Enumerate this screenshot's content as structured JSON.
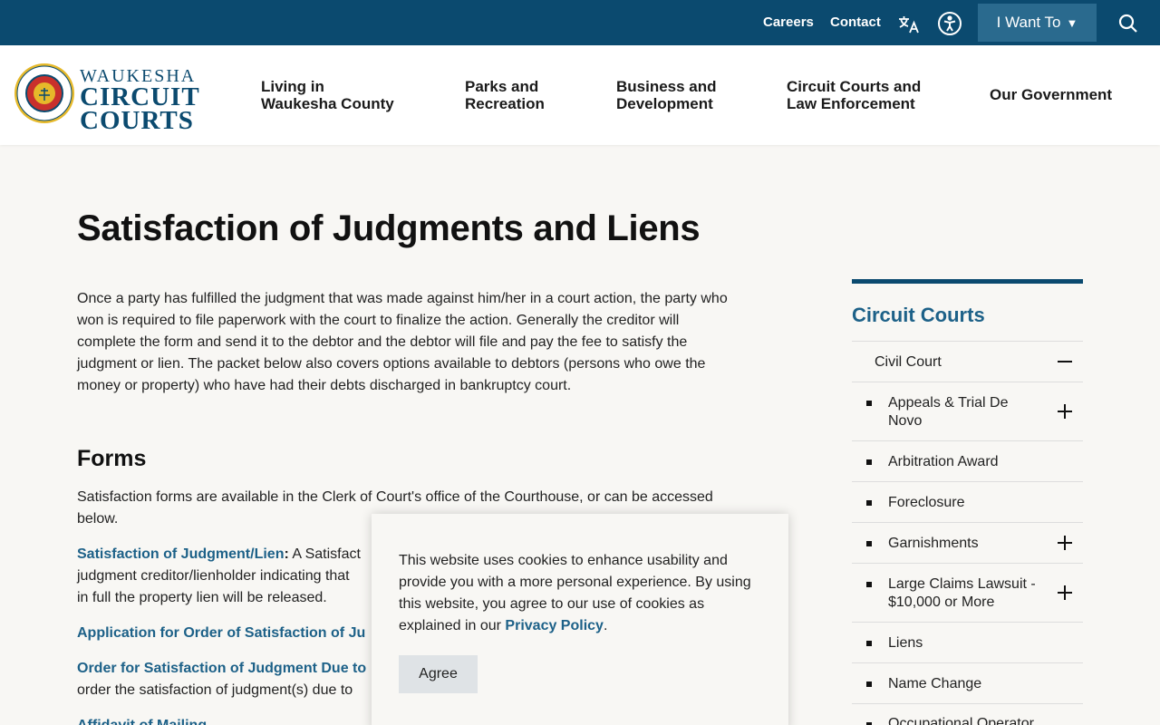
{
  "utility": {
    "careers": "Careers",
    "contact": "Contact",
    "translate_icon": "translate-icon",
    "accessibility_icon": "accessibility-icon",
    "i_want_to": "I Want To",
    "search_icon": "search-icon"
  },
  "logo": {
    "seal_top": "WAUKESHA COUNTY",
    "seal_bottom": "CIRCUIT COURTS",
    "line1": "WAUKESHA",
    "line2": "CIRCUIT",
    "line3": "COURTS"
  },
  "nav": [
    {
      "label": "Living in\nWaukesha County"
    },
    {
      "label": "Parks and\nRecreation"
    },
    {
      "label": "Business and\nDevelopment"
    },
    {
      "label": "Circuit Courts and\nLaw Enforcement"
    },
    {
      "label": "Our Government"
    }
  ],
  "main": {
    "title": "Satisfaction of Judgments and Liens",
    "intro": "Once a party has fulfilled the judgment that was made against him/her in a court action, the party who won is required to file paperwork with the court to finalize the action. Generally the creditor will complete the form and send it to the debtor and the debtor will file and pay the fee to satisfy the judgment or lien.  The packet below also covers options available to debtors (persons who owe the money or property) who have had their debts discharged in bankruptcy court.",
    "forms_heading": "Forms",
    "forms_intro": "Satisfaction forms are available in the Clerk of Court's office of the Courthouse, or can be accessed below.",
    "item1_link": "Satisfaction of Judgment/Lien",
    "item1_colon": ":",
    "item1_text": " A Satisfact",
    "item1_line2": "judgment creditor/lienholder indicating that",
    "item1_line3": "in full the property lien will be released.",
    "item2_link": "Application for Order of Satisfaction of Ju",
    "item3_link": "Order for Satisfaction of Judgment Due to",
    "item3_line2": "order the satisfaction of judgment(s) due to",
    "item4_link": "Affidavit of Mailing"
  },
  "sidebar": {
    "title": "Circuit Courts",
    "items": [
      {
        "label": "Civil Court",
        "toggle": "minus"
      },
      {
        "label": "Appeals & Trial De Novo",
        "toggle": "plus"
      },
      {
        "label": "Arbitration Award",
        "toggle": ""
      },
      {
        "label": "Foreclosure",
        "toggle": ""
      },
      {
        "label": "Garnishments",
        "toggle": "plus"
      },
      {
        "label": "Large Claims Lawsuit - $10,000 or More",
        "toggle": "plus"
      },
      {
        "label": "Liens",
        "toggle": ""
      },
      {
        "label": "Name Change",
        "toggle": ""
      },
      {
        "label": "Occupational Operator",
        "toggle": ""
      }
    ]
  },
  "cookie": {
    "text": "This website uses cookies to enhance usability and provide you with a more personal experience. By using this website, you agree to our use of cookies as explained in our ",
    "link": "Privacy Policy",
    "end": ".",
    "button": "Agree"
  },
  "colors": {
    "brand": "#0b4a6f",
    "link": "#1d6188",
    "background": "#f8f7f4"
  }
}
